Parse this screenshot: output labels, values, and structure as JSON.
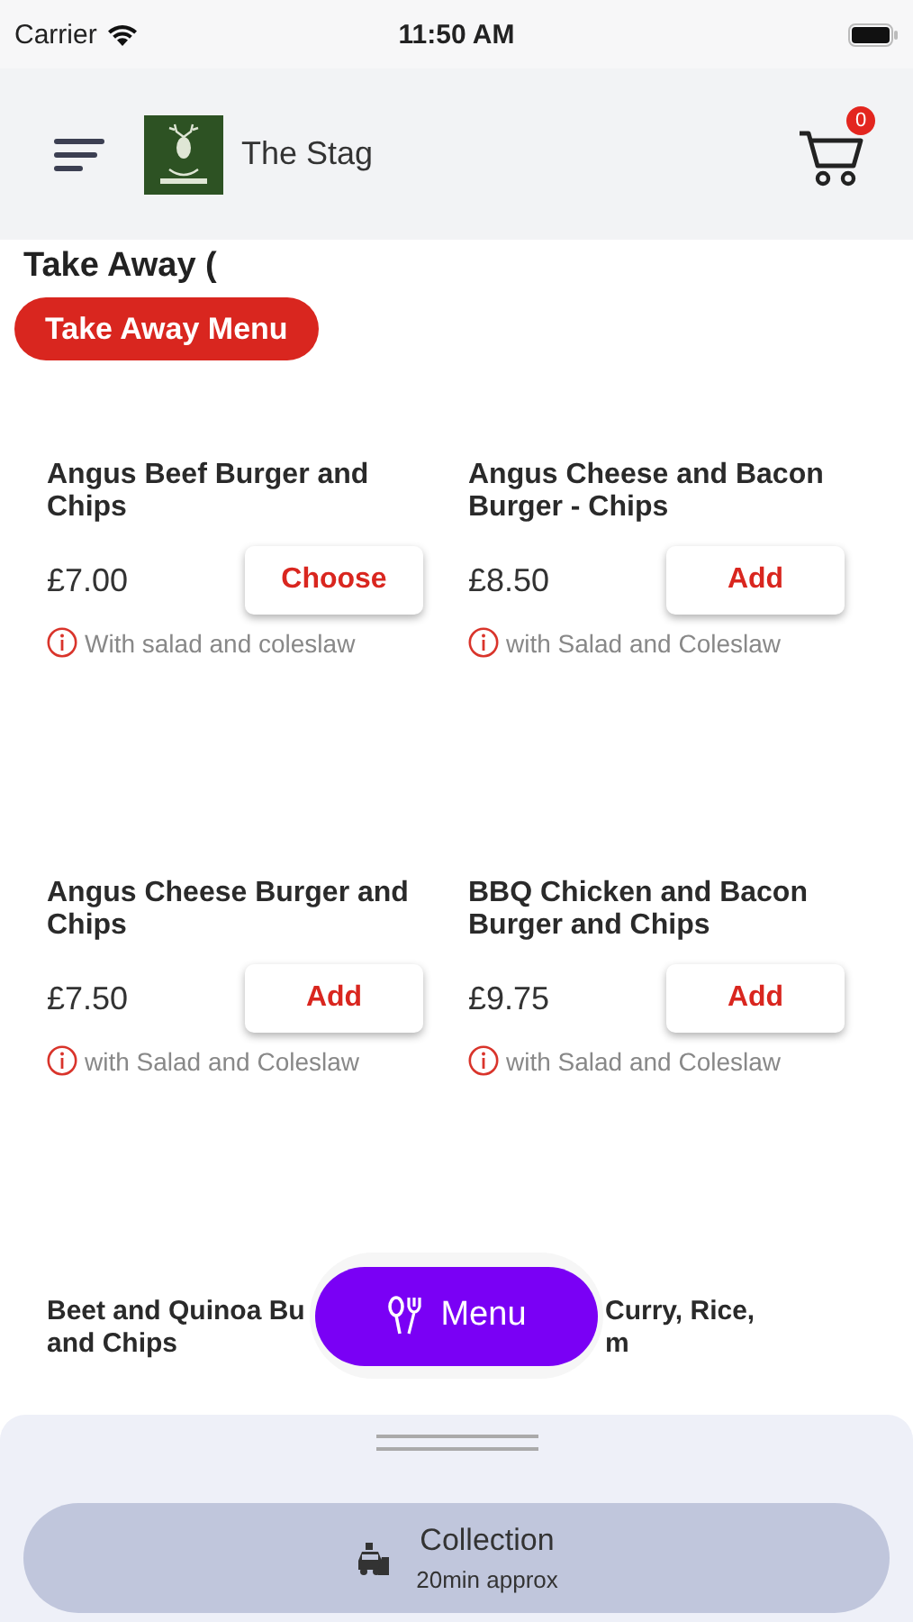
{
  "status_bar": {
    "carrier": "Carrier",
    "time": "11:50 AM"
  },
  "header": {
    "restaurant_name": "The Stag",
    "cart_count": "0"
  },
  "section_title": "Take Away (",
  "menu_tabs": [
    {
      "label": "Take Away Menu",
      "selected": true
    }
  ],
  "items": [
    {
      "kind": "full",
      "name_lines": [
        "Angus Beef Burger and",
        "Chips"
      ],
      "price": "£7.00",
      "action": "Choose",
      "note": "With salad and coleslaw"
    },
    {
      "kind": "full",
      "name_lines": [
        "Angus Cheese and Bacon",
        "Burger - Chips"
      ],
      "price": "£8.50",
      "action": "Add",
      "note": "with Salad and Coleslaw"
    },
    {
      "kind": "full",
      "name_lines": [
        "Angus Cheese Burger and",
        "Chips"
      ],
      "price": "£7.50",
      "action": "Add",
      "note": "with Salad and Coleslaw"
    },
    {
      "kind": "full",
      "name_lines": [
        "BBQ Chicken and Bacon",
        "Burger and Chips"
      ],
      "price": "£9.75",
      "action": "Add",
      "note": "with Salad and Coleslaw"
    },
    {
      "kind": "covered",
      "name_lines": [
        "Beet and Quinoa Bu",
        "and Chips"
      ]
    },
    {
      "kind": "covered_left",
      "name_lines": [
        "Curry, Rice,",
        "m"
      ]
    }
  ],
  "menu_button": {
    "label": "Menu"
  },
  "order_mode": {
    "label": "Collection",
    "subtitle": "20min approx"
  }
}
